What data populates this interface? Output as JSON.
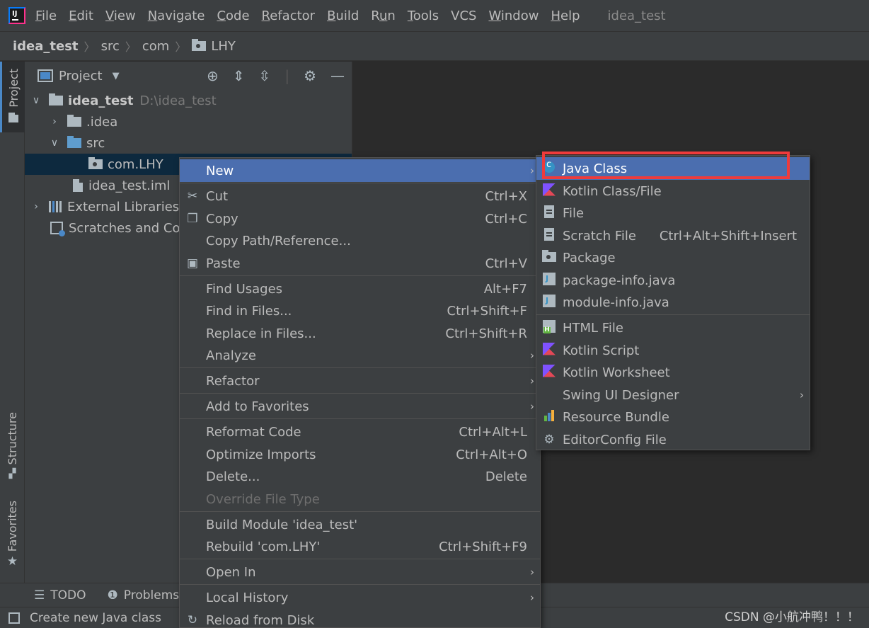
{
  "menubar": {
    "items": [
      "File",
      "Edit",
      "View",
      "Navigate",
      "Code",
      "Refactor",
      "Build",
      "Run",
      "Tools",
      "VCS",
      "Window",
      "Help"
    ],
    "mnemonics": [
      "F",
      "E",
      "V",
      "N",
      "C",
      "R",
      "B",
      "u",
      "T",
      "",
      "W",
      "H"
    ],
    "window_title": "idea_test"
  },
  "breadcrumb": [
    "idea_test",
    "src",
    "com",
    "LHY"
  ],
  "left_strip": {
    "project": "Project",
    "structure": "Structure",
    "favorites": "Favorites"
  },
  "project_panel": {
    "title": "Project",
    "tree": [
      {
        "label": "idea_test",
        "path": "D:\\idea_test"
      },
      {
        "label": ".idea"
      },
      {
        "label": "src"
      },
      {
        "label": "com.LHY"
      },
      {
        "label": "idea_test.iml"
      },
      {
        "label": "External Libraries"
      },
      {
        "label": "Scratches and Cor"
      }
    ]
  },
  "context_menu": {
    "items": [
      {
        "label": "New"
      },
      {
        "label": "Cut",
        "shortcut": "Ctrl+X"
      },
      {
        "label": "Copy",
        "shortcut": "Ctrl+C"
      },
      {
        "label": "Copy Path/Reference..."
      },
      {
        "label": "Paste",
        "shortcut": "Ctrl+V"
      },
      {
        "label": "Find Usages",
        "shortcut": "Alt+F7"
      },
      {
        "label": "Find in Files...",
        "shortcut": "Ctrl+Shift+F"
      },
      {
        "label": "Replace in Files...",
        "shortcut": "Ctrl+Shift+R"
      },
      {
        "label": "Analyze"
      },
      {
        "label": "Refactor"
      },
      {
        "label": "Add to Favorites"
      },
      {
        "label": "Reformat Code",
        "shortcut": "Ctrl+Alt+L"
      },
      {
        "label": "Optimize Imports",
        "shortcut": "Ctrl+Alt+O"
      },
      {
        "label": "Delete...",
        "shortcut": "Delete"
      },
      {
        "label": "Override File Type"
      },
      {
        "label": "Build Module 'idea_test'"
      },
      {
        "label": "Rebuild 'com.LHY'",
        "shortcut": "Ctrl+Shift+F9"
      },
      {
        "label": "Open In"
      },
      {
        "label": "Local History"
      },
      {
        "label": "Reload from Disk"
      }
    ]
  },
  "new_submenu": {
    "items": [
      {
        "label": "Java Class"
      },
      {
        "label": "Kotlin Class/File"
      },
      {
        "label": "File"
      },
      {
        "label": "Scratch File",
        "shortcut": "Ctrl+Alt+Shift+Insert"
      },
      {
        "label": "Package"
      },
      {
        "label": "package-info.java"
      },
      {
        "label": "module-info.java"
      },
      {
        "label": "HTML File"
      },
      {
        "label": "Kotlin Script"
      },
      {
        "label": "Kotlin Worksheet"
      },
      {
        "label": "Swing UI Designer"
      },
      {
        "label": "Resource Bundle"
      },
      {
        "label": "EditorConfig File"
      }
    ]
  },
  "bottom_tools": {
    "todo": "TODO",
    "problems": "Problems"
  },
  "status_bar": {
    "text": "Create new Java class"
  },
  "watermark": "CSDN @小航冲鸭！！！",
  "colors": {
    "highlight": "#4b6eaf",
    "annotation_box": "#ef3b3b",
    "selection": "#0d293e"
  }
}
